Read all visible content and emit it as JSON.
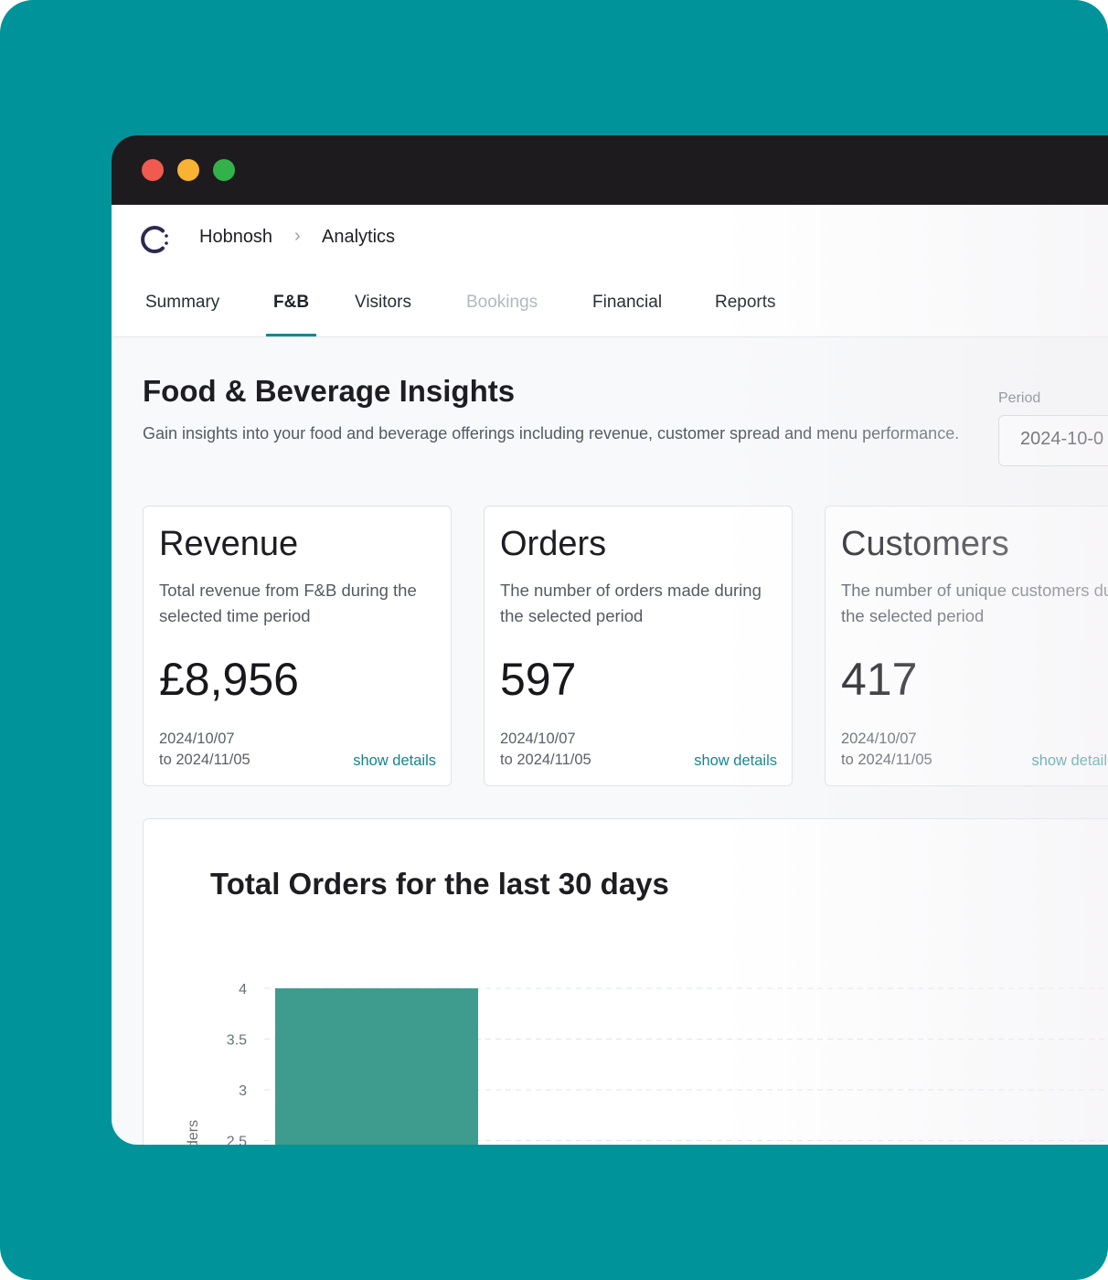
{
  "breadcrumb": {
    "org": "Hobnosh",
    "separator": "›",
    "page": "Analytics"
  },
  "tabs": [
    {
      "label": "Summary"
    },
    {
      "label": "F&B"
    },
    {
      "label": "Visitors"
    },
    {
      "label": "Bookings"
    },
    {
      "label": "Financial"
    },
    {
      "label": "Reports"
    }
  ],
  "header": {
    "title": "Food & Beverage Insights",
    "subtitle": "Gain insights into your food and beverage offerings including revenue, customer spread and menu performance."
  },
  "period": {
    "label": "Period",
    "value": "2024-10-0"
  },
  "cards": [
    {
      "title": "Revenue",
      "description": "Total revenue from F&B during the selected time period",
      "value": "£8,956",
      "from": "2024/10/07",
      "to": "to 2024/11/05",
      "link": "show details"
    },
    {
      "title": "Orders",
      "description": "The number of orders made during the selected period",
      "value": "597",
      "from": "2024/10/07",
      "to": "to 2024/11/05",
      "link": "show details"
    },
    {
      "title": "Customers",
      "description": "The number of unique customers during the selected period",
      "value": "417",
      "from": "2024/10/07",
      "to": "to 2024/11/05",
      "link": "show detail"
    }
  ],
  "chart_data": {
    "type": "bar",
    "title": "Total Orders for the last 30 days",
    "ylabel": "ders",
    "yticks": [
      "4",
      "3.5",
      "3",
      "2.5"
    ],
    "ylim": [
      2.5,
      4
    ],
    "categories": [
      ""
    ],
    "values": [
      4
    ],
    "grid": true,
    "color": "#3d9c8e"
  },
  "colors": {
    "accent": "#13898f",
    "background": "#00949a",
    "titlebar": "#1e1b1e"
  }
}
